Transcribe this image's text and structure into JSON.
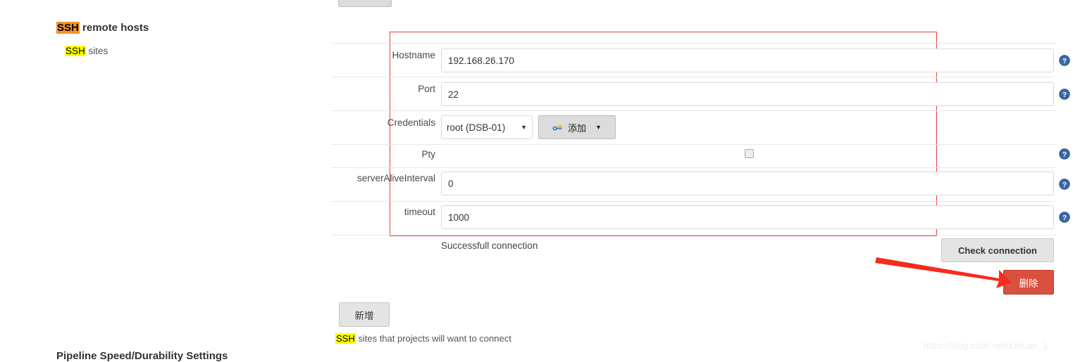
{
  "section": {
    "heading_highlight": "SSH",
    "heading_rest": " remote hosts",
    "subheading_highlight": "SSH",
    "subheading_rest": " sites"
  },
  "form": {
    "rows": [
      {
        "label": "Hostname",
        "value": "192.168.26.170"
      },
      {
        "label": "Port",
        "value": "22"
      },
      {
        "label": "Credentials",
        "value": "root (DSB-01)"
      },
      {
        "label": "Pty",
        "value": ""
      },
      {
        "label": "serverAliveInterval",
        "value": "0"
      },
      {
        "label": "timeout",
        "value": "1000"
      }
    ],
    "credentials": {
      "selected": "root (DSB-01)",
      "caret": "▼",
      "add_button_label": "添加",
      "add_button_caret": "▼",
      "add_button_icon": "key-icon"
    },
    "pty": {
      "checked": false
    },
    "help_icon_name": "help-question-icon",
    "help_icon_glyph": "?"
  },
  "status": {
    "connection_message": "Successfull connection"
  },
  "buttons": {
    "check_connection": "Check connection",
    "delete": "删除",
    "add_site": "新增"
  },
  "footer": {
    "help_text_highlight": "SSH",
    "help_text_rest": " sites that projects will want to connect",
    "next_section_heading": "Pipeline Speed/Durability Settings",
    "watermark": "https://blog.csdn.net/zzhuan_1"
  },
  "colors": {
    "highlight_orange": "#f0932b",
    "highlight_yellow": "#ffff00",
    "focus_box_red": "#e8403a",
    "delete_red": "#d9503f",
    "arrow_red": "#f52b1e",
    "help_icon_blue": "#3a69a8"
  }
}
